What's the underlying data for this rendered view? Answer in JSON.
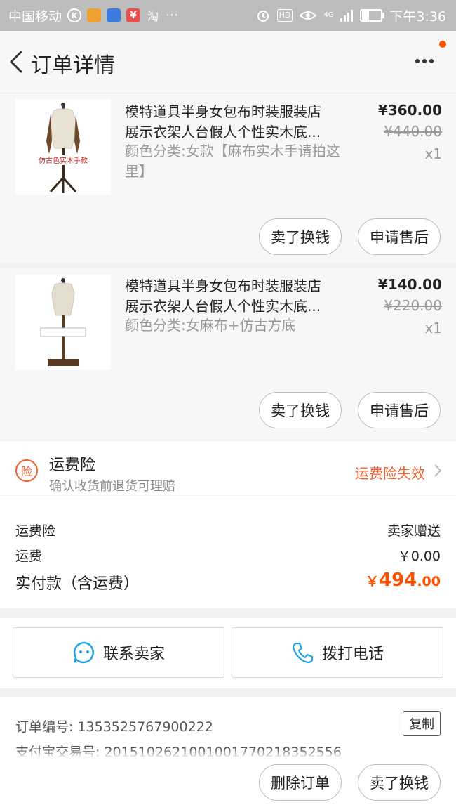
{
  "status_bar": {
    "carrier": "中国移动",
    "taobao_label": "淘",
    "dots": "···",
    "net_label": "4G",
    "hd_label": "HD",
    "time": "下午3:36"
  },
  "header": {
    "title": "订单详情"
  },
  "items": [
    {
      "title_line1": "模特道具半身女包布时装服装店",
      "title_line2": "展示衣架人台假人个性实木底...",
      "sku": "颜色分类:女款【麻布实木手请拍这里】",
      "price": "¥360.00",
      "original_price": "¥440.00",
      "quantity": "x1",
      "thumb_label": "仿古色实木手款",
      "btn_sell": "卖了换钱",
      "btn_aftersale": "申请售后"
    },
    {
      "title_line1": "模特道具半身女包布时装服装店",
      "title_line2": "展示衣架人台假人个性实木底...",
      "sku": "颜色分类:女麻布+仿古方底",
      "price": "¥140.00",
      "original_price": "¥220.00",
      "quantity": "x1",
      "thumb_label": "",
      "btn_sell": "卖了换钱",
      "btn_aftersale": "申请售后"
    }
  ],
  "shipping_insurance": {
    "icon_char": "险",
    "title": "运费险",
    "subtitle": "确认收货前退货可理赔",
    "status": "运费险失效"
  },
  "fees": {
    "insurance_label": "运费险",
    "insurance_value": "卖家赠送",
    "shipping_label": "运费",
    "shipping_value": "￥0.00",
    "total_label": "实付款（含运费）",
    "total_currency": "￥",
    "total_integer": "494",
    "total_decimal": ".00"
  },
  "contact": {
    "seller_label": "联系卖家",
    "phone_label": "拨打电话"
  },
  "order_info": {
    "order_no_label": "订单编号:",
    "order_no": "1353525767900222",
    "alipay_label": "支付宝交易号:",
    "alipay_no": "2015102621001001770218352556",
    "copy_label": "复制",
    "btn_delete": "删除订单",
    "btn_sell": "卖了换钱"
  },
  "colors": {
    "accent": "#ff5000",
    "insurance": "#f06030",
    "contact_icon": "#1fa3e6"
  },
  "icons": [
    "back-arrow-icon",
    "more-icon",
    "chat-bubble-icon",
    "phone-icon",
    "insurance-icon",
    "chevron-right-icon"
  ]
}
